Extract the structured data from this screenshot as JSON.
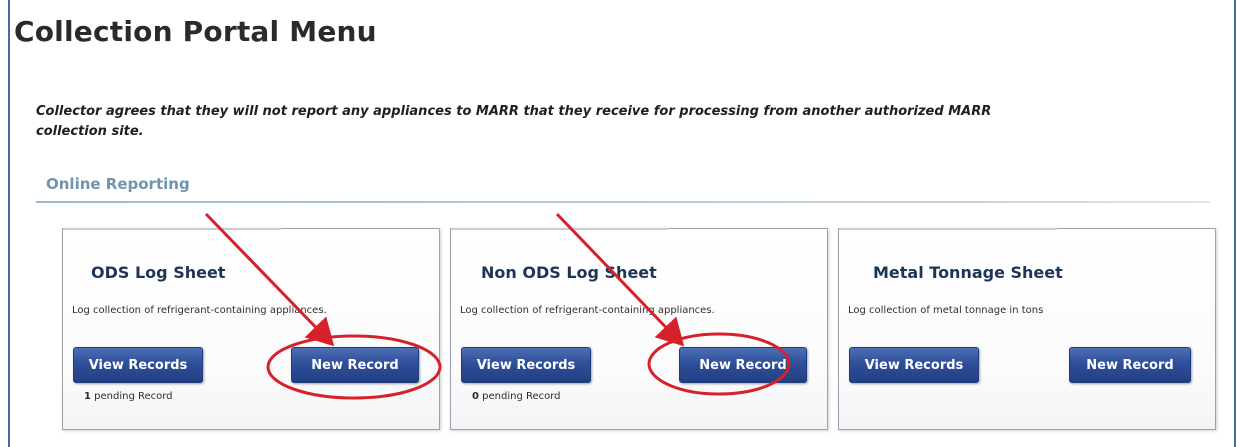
{
  "page": {
    "title": "Collection Portal Menu",
    "disclaimer": "Collector agrees that they will not report any appliances to MARR that they receive for processing from another authorized MARR collection site.",
    "section_heading": "Online Reporting"
  },
  "cards": [
    {
      "title": "ODS Log Sheet",
      "description": "Log collection of refrigerant-containing appliances.",
      "view_label": "View Records",
      "new_label": "New Record",
      "pending_count": "1",
      "pending_suffix": " pending Record"
    },
    {
      "title": "Non ODS Log Sheet",
      "description": "Log collection of refrigerant-containing appliances.",
      "view_label": "View Records",
      "new_label": "New Record",
      "pending_count": "0",
      "pending_suffix": " pending Record"
    },
    {
      "title": "Metal Tonnage Sheet",
      "description": "Log collection of metal tonnage in tons",
      "view_label": "View Records",
      "new_label": "New Record"
    }
  ],
  "colors": {
    "button": "#2e4f99",
    "annotation": "#d6212b",
    "section_heading": "#6f94ad",
    "frame_border": "#3f6ea6"
  }
}
